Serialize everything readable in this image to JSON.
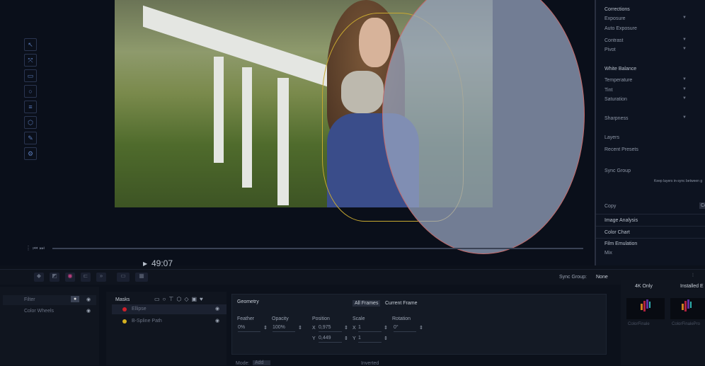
{
  "viewer": {
    "timecode": "49:07",
    "play_icon": "play-icon"
  },
  "inspector": {
    "items": [
      "Corrections",
      "Exposure",
      "Auto Exposure",
      "Contrast",
      "Pivot",
      "White Balance",
      "Temperature",
      "Tint",
      "Saturation",
      "Sharpness",
      "Layers",
      "Recent Presets",
      "Sync Group"
    ],
    "sync_hint": "Keep layers in-sync between g",
    "copy_label": "Copy",
    "copy_button": "Co",
    "sections": [
      "Image Analysis",
      "Color Chart",
      "Film Emulation"
    ],
    "mix": "Mix"
  },
  "toolbar": {
    "sync_group_label": "Sync Group:",
    "sync_group_value": "None"
  },
  "layers": {
    "items": [
      {
        "label": "Filter"
      },
      {
        "label": "Color Wheels"
      }
    ]
  },
  "masks": {
    "title": "Masks",
    "items": [
      {
        "label": "Ellipse",
        "color": "#d0202a"
      },
      {
        "label": "B-Spline Path",
        "color": "#d4b020"
      }
    ]
  },
  "geometry": {
    "title": "Geometry",
    "tabs": [
      "All Frames",
      "Current Frame"
    ],
    "feather_label": "Feather",
    "feather": "0%",
    "opacity_label": "Opacity",
    "opacity": "100%",
    "position_label": "Position",
    "pos_x": "0,975",
    "pos_y": "0,449",
    "scale_label": "Scale",
    "scale_x": "1",
    "scale_y": "1",
    "rotation_label": "Rotation",
    "rotation": "0°",
    "x": "X",
    "y": "Y",
    "mode_label": "Mode:",
    "mode": "Add",
    "inverted": "Inverted"
  },
  "presets": {
    "filter": "4K Only",
    "tab": "Installed E",
    "items": [
      "ColorFinale",
      "ColorFinalePro"
    ]
  }
}
